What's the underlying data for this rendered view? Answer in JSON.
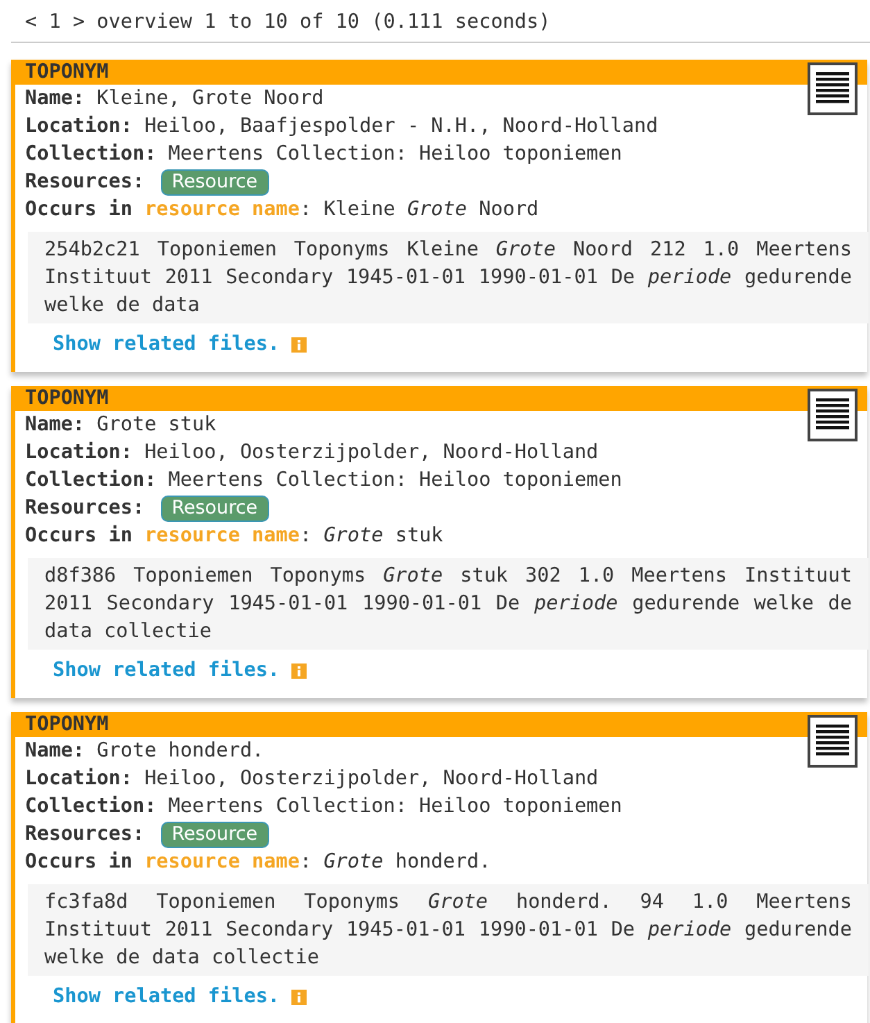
{
  "pager": {
    "prev": "<",
    "page": "1",
    "next": ">",
    "summary": "overview 1 to 10 of 10 (0.111 seconds)"
  },
  "results": [
    {
      "type": "TOPONYM",
      "fields": [
        {
          "label": "Name:",
          "value": "Kleine, Grote Noord"
        },
        {
          "label": "Location:",
          "value": "Heiloo, Baafjespolder - N.H., Noord-Holland"
        },
        {
          "label": "Collection:",
          "value": "Meertens Collection: Heiloo toponiemen"
        }
      ],
      "resources": {
        "label": "Resources:",
        "badges": [
          "Resource"
        ]
      },
      "occurs": {
        "prefix": "Occurs in",
        "field": "resource name",
        "separator": ":",
        "value": "Kleine *Grote* Noord"
      },
      "snippet": "254b2c21 Toponiemen Toponyms Kleine *Grote* Noord 212 1.0 Meertens Instituut 2011 Secondary 1945-01-01 1990-01-01 De *periode* gedurende welke de data",
      "link": "Show related files."
    },
    {
      "type": "TOPONYM",
      "fields": [
        {
          "label": "Name:",
          "value": "Grote stuk"
        },
        {
          "label": "Location:",
          "value": "Heiloo, Oosterzijpolder, Noord-Holland"
        },
        {
          "label": "Collection:",
          "value": "Meertens Collection: Heiloo toponiemen"
        }
      ],
      "resources": {
        "label": "Resources:",
        "badges": [
          "Resource"
        ]
      },
      "occurs": {
        "prefix": "Occurs in",
        "field": "resource name",
        "separator": ":",
        "value": "*Grote* stuk"
      },
      "snippet": "d8f386 Toponiemen Toponyms *Grote* stuk 302 1.0 Meertens Instituut 2011 Secondary 1945-01-01 1990-01-01 De *periode* gedurende welke de data collectie",
      "link": "Show related files."
    },
    {
      "type": "TOPONYM",
      "fields": [
        {
          "label": "Name:",
          "value": "Grote honderd."
        },
        {
          "label": "Location:",
          "value": "Heiloo, Oosterzijpolder, Noord-Holland"
        },
        {
          "label": "Collection:",
          "value": "Meertens Collection: Heiloo toponiemen"
        }
      ],
      "resources": {
        "label": "Resources:",
        "badges": [
          "Resource"
        ]
      },
      "occurs": {
        "prefix": "Occurs in",
        "field": "resource name",
        "separator": ":",
        "value": "*Grote* honderd."
      },
      "snippet": "fc3fa8d Toponiemen Toponyms *Grote* honderd. 94 1.0 Meertens Instituut 2011 Secondary 1945-01-01 1990-01-01 De *periode* gedurende welke de data collectie",
      "link": "Show related files."
    }
  ]
}
